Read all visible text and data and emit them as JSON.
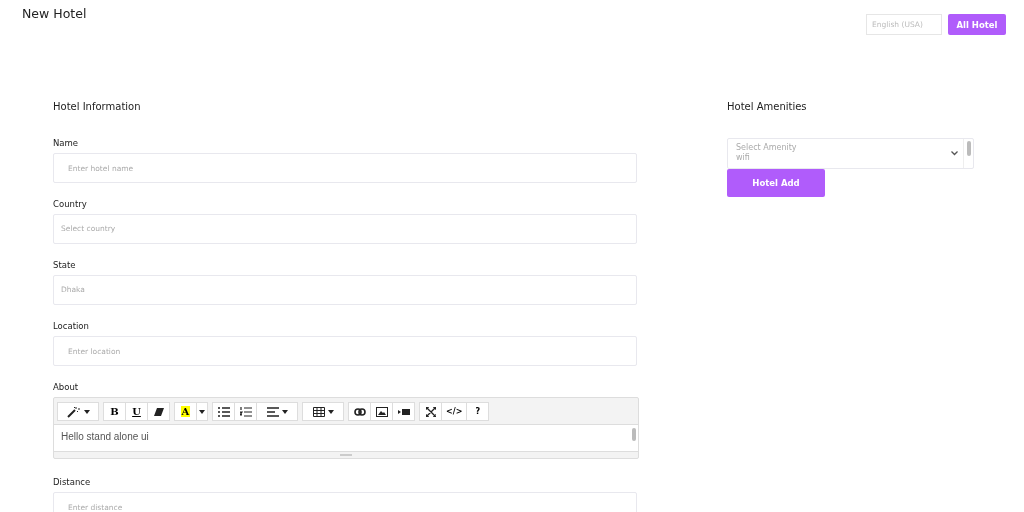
{
  "page_title": "New Hotel",
  "header": {
    "language": {
      "placeholder": "English (USA)"
    },
    "button": "All Hotel"
  },
  "hotel_information": {
    "title": "Hotel Information",
    "fields": [
      {
        "label": "Name",
        "kind": "input",
        "placeholder": "Enter hotel name"
      },
      {
        "label": "Country",
        "kind": "select",
        "placeholder": "Select country"
      },
      {
        "label": "State",
        "kind": "select",
        "placeholder": "Dhaka"
      },
      {
        "label": "Location",
        "kind": "input",
        "placeholder": "Enter location"
      },
      {
        "label": "About",
        "kind": "editor",
        "value": "Hello stand alone ui"
      },
      {
        "label": "Distance",
        "kind": "input",
        "placeholder": "Enter distance"
      }
    ]
  },
  "editor_toolbar": [
    [
      {
        "kind": "wand",
        "dropdown": true
      }
    ],
    [
      {
        "kind": "bold",
        "label": "B"
      },
      {
        "kind": "underline",
        "label": "U"
      },
      {
        "kind": "eraser"
      }
    ],
    [
      {
        "kind": "highlight",
        "label": "A"
      },
      {
        "kind": "caret"
      }
    ],
    [
      {
        "kind": "bullets"
      },
      {
        "kind": "numbers"
      },
      {
        "kind": "align",
        "dropdown": true
      }
    ],
    [
      {
        "kind": "table",
        "dropdown": true
      }
    ],
    [
      {
        "kind": "link"
      },
      {
        "kind": "image"
      },
      {
        "kind": "video"
      }
    ],
    [
      {
        "kind": "expand"
      },
      {
        "kind": "text",
        "label": "</>"
      },
      {
        "kind": "text",
        "label": "?"
      }
    ]
  ],
  "hotel_amenities": {
    "title": "Hotel Amenities",
    "options": [
      "Select Amenity",
      "wifi"
    ],
    "button": "Hotel Add"
  }
}
